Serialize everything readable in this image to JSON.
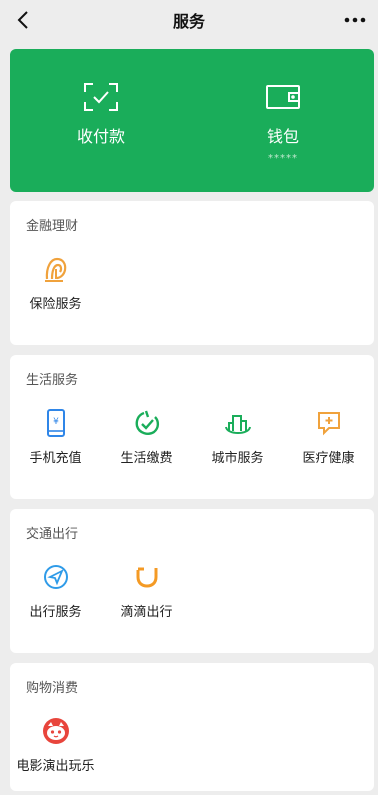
{
  "header": {
    "title": "服务"
  },
  "wallet_panel": {
    "pay": {
      "label": "收付款",
      "icon": "scan-check-icon"
    },
    "wallet": {
      "label": "钱包",
      "masked_balance": "*****",
      "icon": "wallet-icon"
    }
  },
  "sections": [
    {
      "title": "金融理财",
      "items": [
        {
          "label": "保险服务",
          "icon": "insurance-icon"
        }
      ]
    },
    {
      "title": "生活服务",
      "items": [
        {
          "label": "手机充值",
          "icon": "mobile-recharge-icon"
        },
        {
          "label": "生活缴费",
          "icon": "bill-payment-icon"
        },
        {
          "label": "城市服务",
          "icon": "city-service-icon"
        },
        {
          "label": "医疗健康",
          "icon": "medical-icon"
        }
      ]
    },
    {
      "title": "交通出行",
      "items": [
        {
          "label": "出行服务",
          "icon": "travel-navigation-icon"
        },
        {
          "label": "滴滴出行",
          "icon": "didi-icon"
        }
      ]
    },
    {
      "title": "购物消费",
      "items": [
        {
          "label": "电影演出玩乐",
          "icon": "movie-cat-icon"
        }
      ]
    }
  ],
  "colors": {
    "brand_green": "#1aad5a",
    "background": "#ededed"
  }
}
